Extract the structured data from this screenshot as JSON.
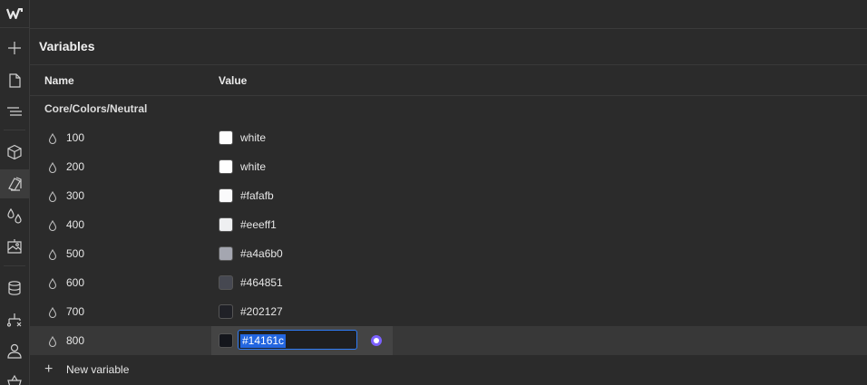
{
  "app": {
    "logo_icon": "webflow-logo-icon"
  },
  "rail": {
    "icons": [
      "add-icon",
      "page-icon",
      "navigator-icon",
      "components-icon",
      "variables-icon",
      "swatches-icon",
      "assets-icon",
      "cms-icon",
      "logic-icon",
      "users-icon",
      "ecommerce-icon"
    ]
  },
  "panel": {
    "title": "Variables",
    "columns": {
      "name": "Name",
      "value": "Value"
    },
    "group": "Core/Colors/Neutral",
    "rows": [
      {
        "name": "100",
        "value": "white",
        "color": "#ffffff"
      },
      {
        "name": "200",
        "value": "white",
        "color": "#ffffff"
      },
      {
        "name": "300",
        "value": "#fafafb",
        "color": "#fafafb"
      },
      {
        "name": "400",
        "value": "#eeeff1",
        "color": "#eeeff1"
      },
      {
        "name": "500",
        "value": "#a4a6b0",
        "color": "#a4a6b0"
      },
      {
        "name": "600",
        "value": "#464851",
        "color": "#464851"
      },
      {
        "name": "700",
        "value": "#202127",
        "color": "#202127"
      },
      {
        "name": "800",
        "value": "#14161c",
        "color": "#14161c",
        "editing": true
      }
    ],
    "new_variable": "New variable"
  },
  "colors": {
    "accent": "#2f7cf6",
    "picker": "#7b61ff",
    "background": "#2b2b2b"
  }
}
